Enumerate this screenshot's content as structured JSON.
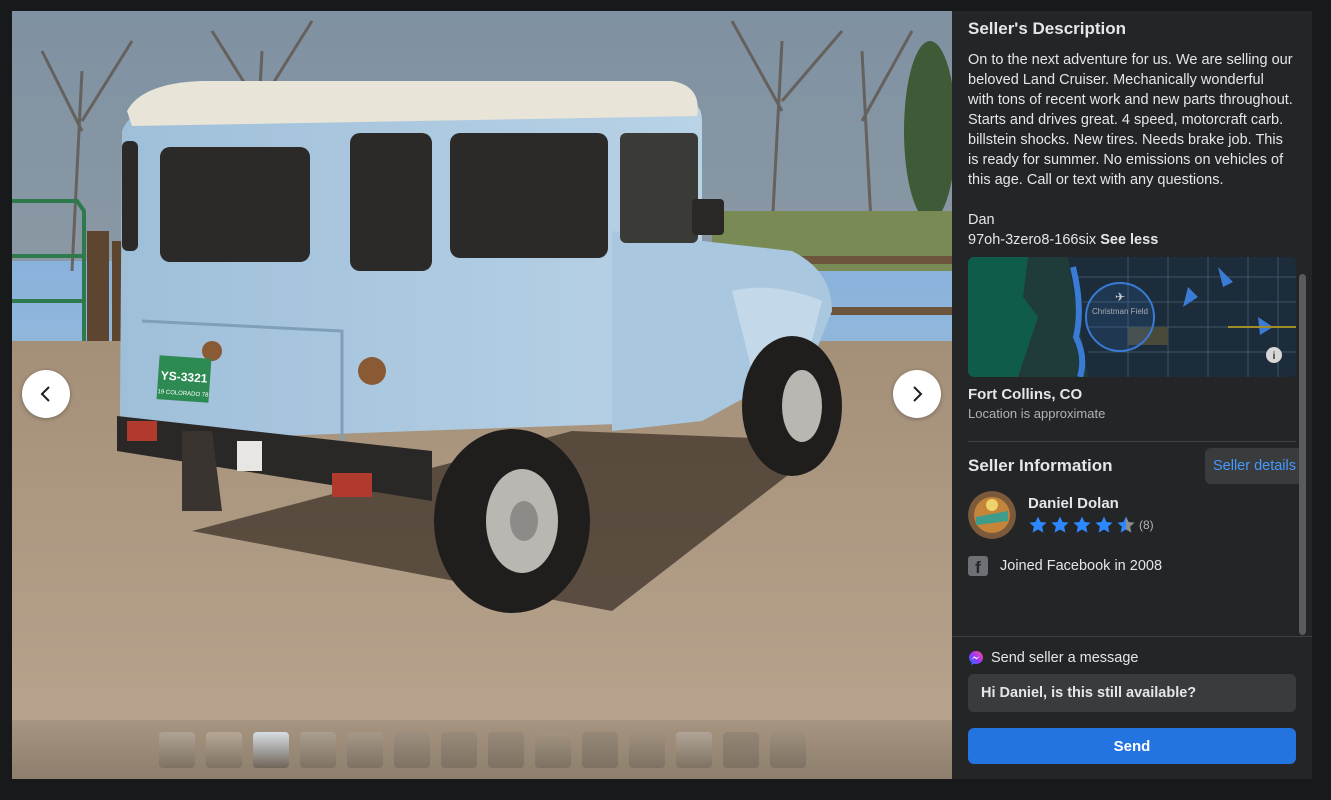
{
  "listing": {
    "description_title": "Seller's Description",
    "description": "On to the next adventure for us. We are selling our beloved Land Cruiser. Mechanically wonderful with tons of recent work and new parts throughout. Starts and drives great. 4 speed, motorcraft carb. billstein shocks. New tires. Needs brake job. This is ready for summer. No emissions on vehicles of this age. Call or text with any questions.",
    "contact_name": "Dan",
    "contact_phone": "97oh-3zero8-166six",
    "see_less": "See less",
    "map_label": "Christman Field",
    "location": "Fort Collins, CO",
    "location_note": "Location is approximate"
  },
  "photo": {
    "plate_text": "YS-3321",
    "plate_sub": "19 COLORADO 78",
    "thumbnail_count": 14,
    "active_thumbnail": 3
  },
  "seller": {
    "section_title": "Seller Information",
    "details_button": "Seller details",
    "name": "Daniel Dolan",
    "rating": 4.5,
    "rating_count": "(8)",
    "joined": "Joined Facebook in 2008"
  },
  "message": {
    "label": "Send seller a message",
    "input_value": "Hi Daniel, is this still available?",
    "send_button": "Send"
  },
  "colors": {
    "panel_bg": "#242526",
    "accent": "#2374e1",
    "star": "#2d88ff",
    "link": "#4599ff"
  }
}
